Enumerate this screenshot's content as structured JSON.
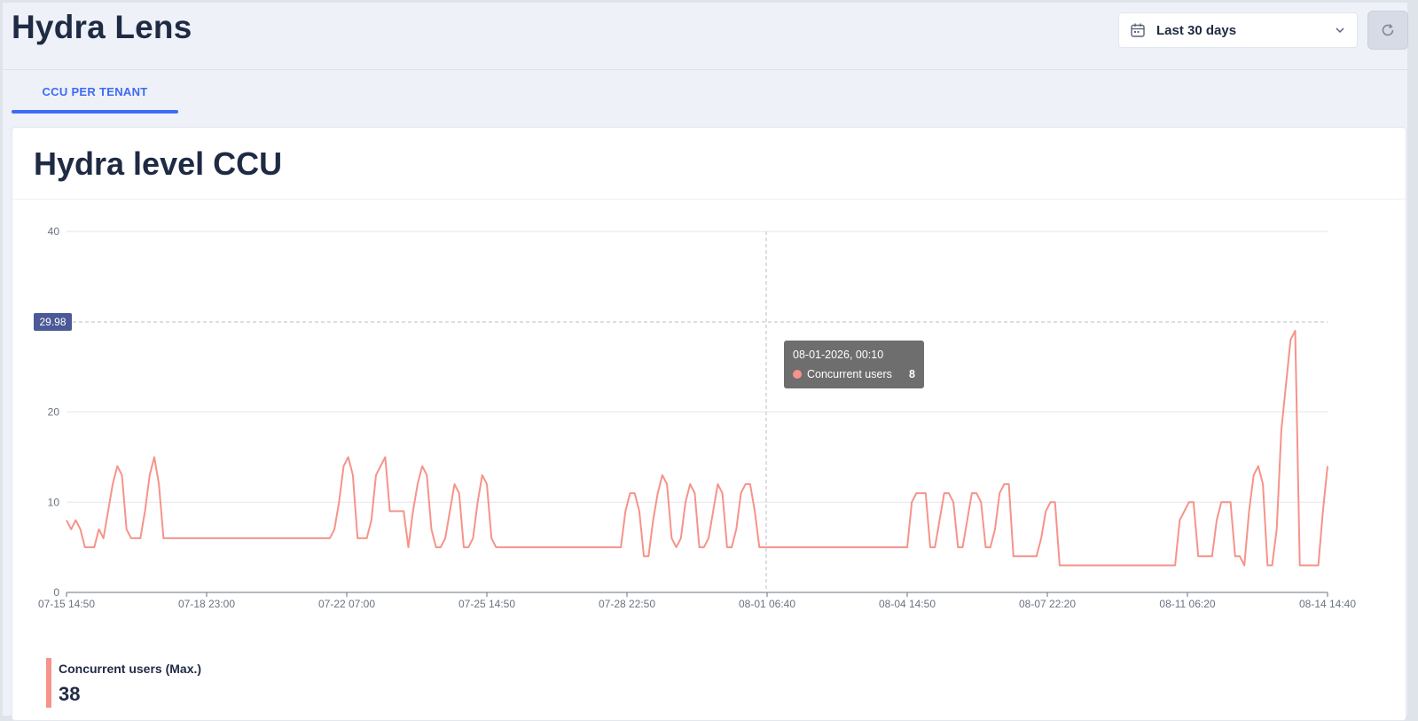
{
  "app": {
    "title": "Hydra Lens"
  },
  "header": {
    "date_range": "Last 30 days",
    "icons": {
      "calendar": "calendar-icon",
      "chevron": "chevron-down-icon",
      "refresh": "refresh-icon"
    }
  },
  "tabs": [
    {
      "label": "CCU PER TENANT",
      "active": true
    }
  ],
  "colors": {
    "accent": "#3d6bf5",
    "series": "#f6938a",
    "marker_badge": "#4b5a96",
    "tooltip_bg": "#666666"
  },
  "card": {
    "title": "Hydra level CCU"
  },
  "legend": {
    "name": "Concurrent users (Max.)",
    "value": "38"
  },
  "tooltip": {
    "time": "08-01-2026, 00:10",
    "series": "Concurrent users",
    "value": "8"
  },
  "chart_data": {
    "type": "line",
    "title": "Hydra level CCU",
    "xlabel": "",
    "ylabel": "",
    "ylim": [
      0,
      40
    ],
    "yticks": [
      0,
      10,
      20,
      40
    ],
    "grid": true,
    "reference_line": {
      "value": 29.98,
      "label": "29.98"
    },
    "hover_x": "08-01 00:10",
    "xticks": [
      "07-15 14:50",
      "07-18 23:00",
      "07-22 07:00",
      "07-25 14:50",
      "07-28 22:50",
      "08-01 06:40",
      "08-04 14:50",
      "08-07 22:20",
      "08-11 06:20",
      "08-14 14:40"
    ],
    "series": [
      {
        "name": "Concurrent users",
        "x_start": "07-15 14:50",
        "x_end": "08-14 14:40",
        "values": [
          8,
          7,
          8,
          7,
          5,
          5,
          5,
          7,
          6,
          9,
          12,
          14,
          13,
          7,
          6,
          6,
          6,
          9,
          13,
          15,
          12,
          6,
          6,
          6,
          6,
          6,
          6,
          6,
          6,
          6,
          6,
          6,
          6,
          6,
          6,
          6,
          6,
          6,
          6,
          6,
          6,
          6,
          6,
          6,
          6,
          6,
          6,
          6,
          6,
          6,
          6,
          6,
          6,
          6,
          6,
          6,
          6,
          6,
          7,
          10,
          14,
          15,
          13,
          6,
          6,
          6,
          8,
          13,
          14,
          15,
          9,
          9,
          9,
          9,
          5,
          9,
          12,
          14,
          13,
          7,
          5,
          5,
          6,
          9,
          12,
          11,
          5,
          5,
          6,
          10,
          13,
          12,
          6,
          5,
          5,
          5,
          5,
          5,
          5,
          5,
          5,
          5,
          5,
          5,
          5,
          5,
          5,
          5,
          5,
          5,
          5,
          5,
          5,
          5,
          5,
          5,
          5,
          5,
          5,
          5,
          5,
          9,
          11,
          11,
          9,
          4,
          4,
          8,
          11,
          13,
          12,
          6,
          5,
          6,
          10,
          12,
          11,
          5,
          5,
          6,
          9,
          12,
          11,
          5,
          5,
          7,
          11,
          12,
          12,
          9,
          5,
          5,
          5,
          5,
          5,
          5,
          5,
          5,
          5,
          5,
          5,
          5,
          5,
          5,
          5,
          5,
          5,
          5,
          5,
          5,
          5,
          5,
          5,
          5,
          5,
          5,
          5,
          5,
          5,
          5,
          5,
          5,
          5,
          10,
          11,
          11,
          11,
          5,
          5,
          8,
          11,
          11,
          10,
          5,
          5,
          8,
          11,
          11,
          10,
          5,
          5,
          7,
          11,
          12,
          12,
          4,
          4,
          4,
          4,
          4,
          4,
          6,
          9,
          10,
          10,
          3,
          3,
          3,
          3,
          3,
          3,
          3,
          3,
          3,
          3,
          3,
          3,
          3,
          3,
          3,
          3,
          3,
          3,
          3,
          3,
          3,
          3,
          3,
          3,
          3,
          3,
          8,
          9,
          10,
          10,
          4,
          4,
          4,
          4,
          8,
          10,
          10,
          10,
          4,
          4,
          3,
          9,
          13,
          14,
          12,
          3,
          3,
          7,
          18,
          23,
          28,
          29,
          3,
          3,
          3,
          3,
          3,
          9,
          14
        ]
      }
    ]
  }
}
